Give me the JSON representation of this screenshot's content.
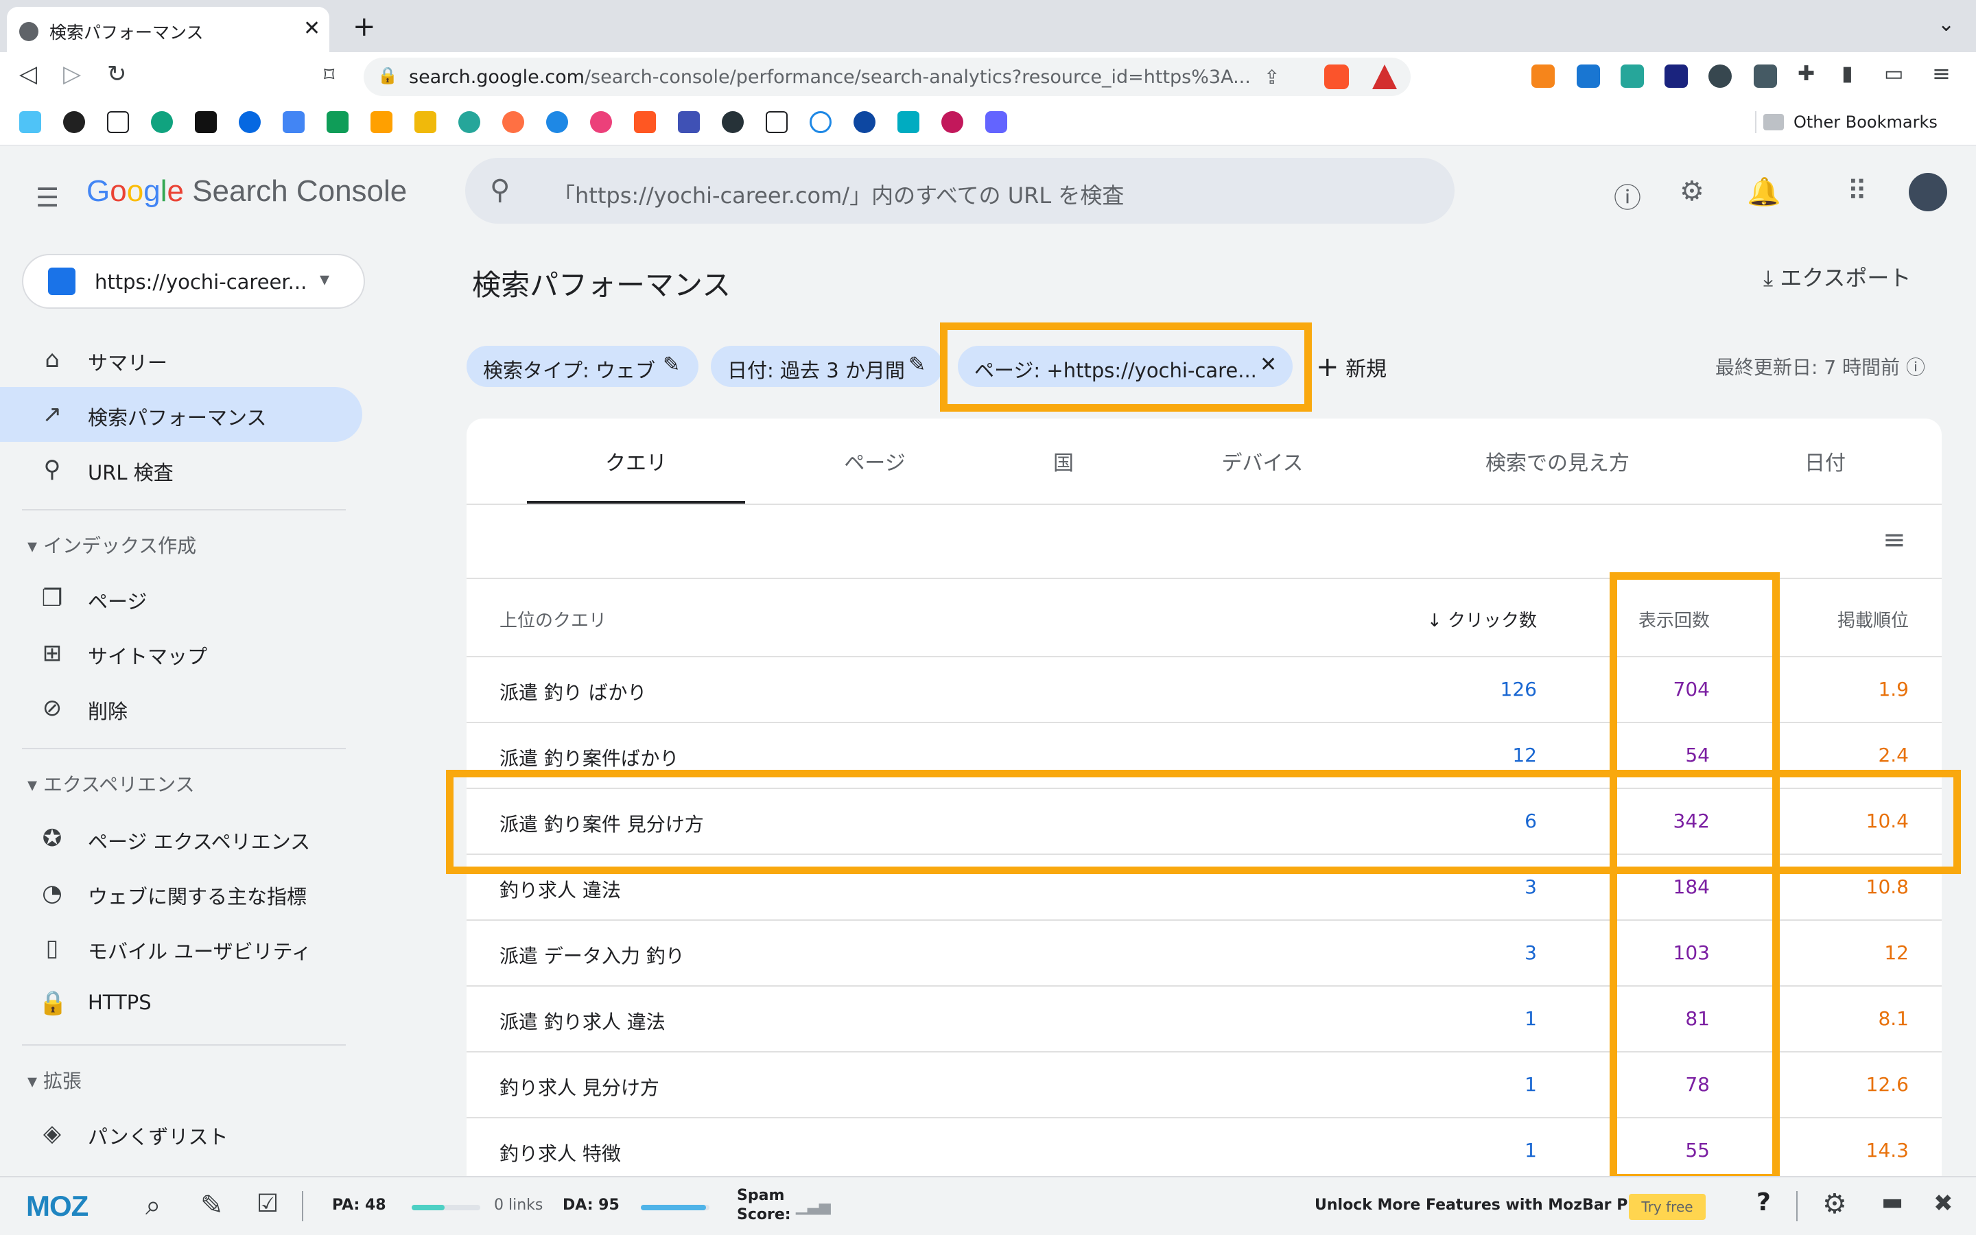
{
  "browser": {
    "tab_title": "検索パフォーマンス",
    "url_host": "search.google.com",
    "url_path": "/search-console/performance/search-analytics?resource_id=https%3A...",
    "other_bookmarks": "Other Bookmarks"
  },
  "header": {
    "logo": {
      "g1": "G",
      "g2": "o",
      "g3": "o",
      "g4": "g",
      "g5": "l",
      "g6": "e",
      "rest": "Search Console"
    },
    "search_placeholder": "「https://yochi-career.com/」内のすべての URL を検査"
  },
  "sidebar": {
    "property": "https://yochi-career...",
    "items": [
      {
        "label": "サマリー",
        "icon": "home-icon"
      },
      {
        "label": "検索パフォーマンス",
        "icon": "trending-icon"
      },
      {
        "label": "URL 検査",
        "icon": "search-icon"
      }
    ],
    "index_section": "インデックス作成",
    "index_items": [
      {
        "label": "ページ"
      },
      {
        "label": "サイトマップ"
      },
      {
        "label": "削除"
      }
    ],
    "experience_section": "エクスペリエンス",
    "experience_items": [
      {
        "label": "ページ エクスペリエンス"
      },
      {
        "label": "ウェブに関する主な指標"
      },
      {
        "label": "モバイル ユーザビリティ"
      },
      {
        "label": "HTTPS"
      }
    ],
    "ext_section": "拡張",
    "ext_items": [
      {
        "label": "パンくずリスト"
      }
    ]
  },
  "main": {
    "title": "検索パフォーマンス",
    "export": "エクスポート",
    "chips": [
      {
        "label": "検索タイプ: ウェブ"
      },
      {
        "label": "日付: 過去 3 か月間"
      },
      {
        "label": "ページ: +https://yochi-care..."
      }
    ],
    "new_label": "新規",
    "last_updated": "最終更新日: 7 時間前",
    "tabs": [
      "クエリ",
      "ページ",
      "国",
      "デバイス",
      "検索での見え方",
      "日付"
    ],
    "table": {
      "headers": {
        "query": "上位のクエリ",
        "clicks": "クリック数",
        "impressions": "表示回数",
        "position": "掲載順位"
      },
      "rows": [
        {
          "query": "派遣 釣り ばかり",
          "clicks": "126",
          "impressions": "704",
          "position": "1.9"
        },
        {
          "query": "派遣 釣り案件ばかり",
          "clicks": "12",
          "impressions": "54",
          "position": "2.4"
        },
        {
          "query": "派遣 釣り案件 見分け方",
          "clicks": "6",
          "impressions": "342",
          "position": "10.4"
        },
        {
          "query": "釣り求人 違法",
          "clicks": "3",
          "impressions": "184",
          "position": "10.8"
        },
        {
          "query": "派遣 データ入力 釣り",
          "clicks": "3",
          "impressions": "103",
          "position": "12"
        },
        {
          "query": "派遣 釣り求人 違法",
          "clicks": "1",
          "impressions": "81",
          "position": "8.1"
        },
        {
          "query": "釣り求人 見分け方",
          "clicks": "1",
          "impressions": "78",
          "position": "12.6"
        },
        {
          "query": "釣り求人 特徴",
          "clicks": "1",
          "impressions": "55",
          "position": "14.3"
        }
      ]
    }
  },
  "mozbar": {
    "logo": "MOZ",
    "pa": "PA: 48",
    "links": "0 links",
    "da": "DA: 95",
    "spam": "Spam",
    "score": "Score:",
    "unlock": "Unlock More Features with MozBar Premium",
    "try_free": "Try free",
    "help": "?"
  },
  "colors": {
    "highlight": "#f9a80e",
    "clicks": "#1967d2",
    "impressions": "#7b1fa2",
    "position": "#e8710a",
    "active_nav": "#d2e3fc"
  }
}
